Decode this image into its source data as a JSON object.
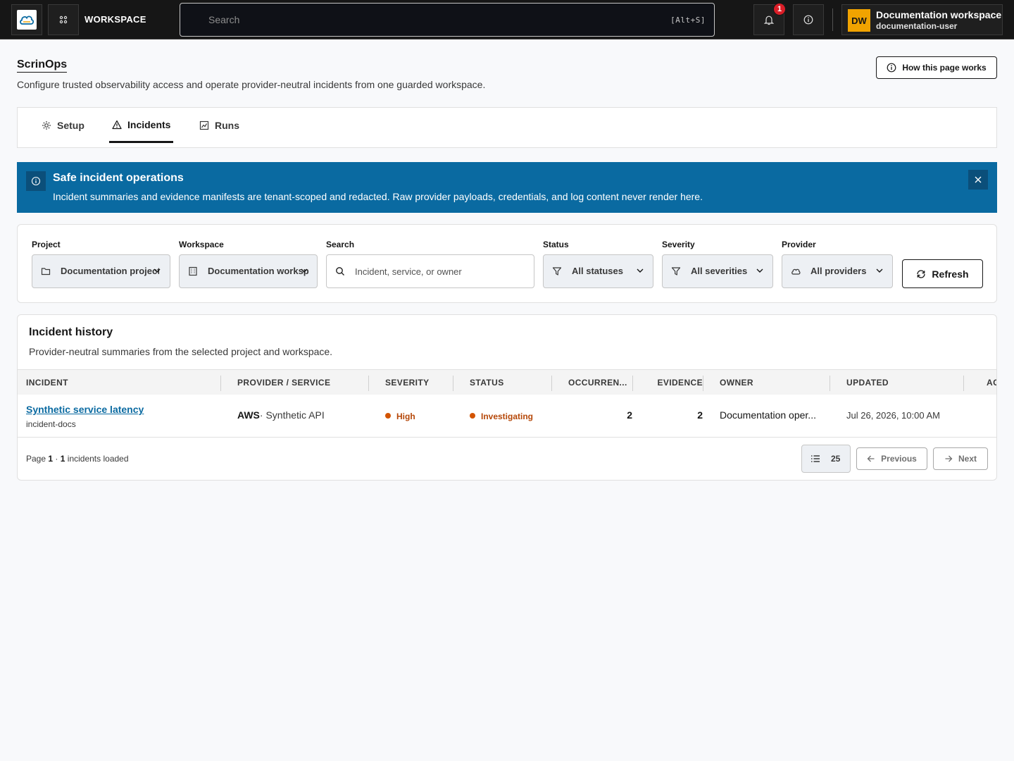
{
  "topbar": {
    "workspace_label": "WORKSPACE",
    "search_placeholder": "Search",
    "search_shortcut": "[Alt+S]",
    "notification_count": "1",
    "user": {
      "initials": "DW",
      "name": "Documentation workspace",
      "id": "documentation-user"
    }
  },
  "page": {
    "title": "ScrinOps",
    "subtitle": "Configure trusted observability access and operate provider-neutral incidents from one guarded workspace.",
    "help_button": "How this page works"
  },
  "tabs": [
    {
      "label": "Setup",
      "icon": "gear-icon",
      "active": false
    },
    {
      "label": "Incidents",
      "icon": "warning-icon",
      "active": true
    },
    {
      "label": "Runs",
      "icon": "chart-icon",
      "active": false
    }
  ],
  "banner": {
    "title": "Safe incident operations",
    "text": "Incident summaries and evidence manifests are tenant-scoped and redacted. Raw provider payloads, credentials, and log content never render here."
  },
  "filters": {
    "project": {
      "label": "Project",
      "value": "Documentation project"
    },
    "workspace": {
      "label": "Workspace",
      "value": "Documentation workspace"
    },
    "search": {
      "label": "Search",
      "placeholder": "Incident, service, or owner"
    },
    "status": {
      "label": "Status",
      "value": "All statuses"
    },
    "severity": {
      "label": "Severity",
      "value": "All severities"
    },
    "provider": {
      "label": "Provider",
      "value": "All providers"
    },
    "refresh_label": "Refresh"
  },
  "incidents": {
    "title": "Incident history",
    "subtitle": "Provider-neutral summaries from the selected project and workspace.",
    "columns": [
      "INCIDENT",
      "PROVIDER / SERVICE",
      "SEVERITY",
      "STATUS",
      "OCCURREN...",
      "EVIDENCE",
      "OWNER",
      "UPDATED",
      "AC"
    ],
    "rows": [
      {
        "name": "Synthetic service latency",
        "id": "incident-docs",
        "provider": "AWS",
        "service": "· Synthetic API",
        "severity": "High",
        "status": "Investigating",
        "occurrences": "2",
        "evidence": "2",
        "owner": "Documentation oper...",
        "updated": "Jul 26, 2026, 10:00 AM"
      }
    ],
    "footer": {
      "page_prefix": "Page",
      "page_number": "1",
      "separator": "·",
      "loaded_count": "1",
      "loaded_suffix": "incidents loaded",
      "page_size": "25",
      "previous_label": "Previous",
      "next_label": "Next"
    }
  },
  "colors": {
    "banner": "#0a6aa1",
    "warning": "#d35400",
    "link": "#0a6aa1",
    "avatar": "#f1a300",
    "badge": "#da1e28"
  }
}
